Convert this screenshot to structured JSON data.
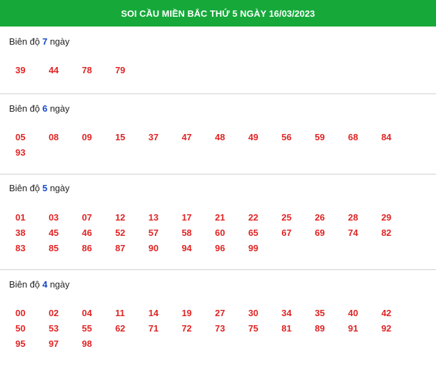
{
  "header": {
    "title": "SOI CẦU MIỀN BẮC THỨ 5 NGÀY 16/03/2023"
  },
  "sections": [
    {
      "label_prefix": "Biên độ",
      "days": "7",
      "label_suffix": "ngày",
      "numbers": [
        "39",
        "44",
        "78",
        "79"
      ]
    },
    {
      "label_prefix": "Biên độ",
      "days": "6",
      "label_suffix": "ngày",
      "numbers": [
        "05",
        "08",
        "09",
        "15",
        "37",
        "47",
        "48",
        "49",
        "56",
        "59",
        "68",
        "84",
        "93"
      ]
    },
    {
      "label_prefix": "Biên độ",
      "days": "5",
      "label_suffix": "ngày",
      "numbers": [
        "01",
        "03",
        "07",
        "12",
        "13",
        "17",
        "21",
        "22",
        "25",
        "26",
        "28",
        "29",
        "38",
        "45",
        "46",
        "52",
        "57",
        "58",
        "60",
        "65",
        "67",
        "69",
        "74",
        "82",
        "83",
        "85",
        "86",
        "87",
        "90",
        "94",
        "96",
        "99"
      ]
    },
    {
      "label_prefix": "Biên độ",
      "days": "4",
      "label_suffix": "ngày",
      "numbers": [
        "00",
        "02",
        "04",
        "11",
        "14",
        "19",
        "27",
        "30",
        "34",
        "35",
        "40",
        "42",
        "50",
        "53",
        "55",
        "62",
        "71",
        "72",
        "73",
        "75",
        "81",
        "89",
        "91",
        "92",
        "95",
        "97",
        "98"
      ]
    }
  ],
  "colors": {
    "header_bg": "#16a93a",
    "number": "#e02424",
    "days_highlight": "#1446c8"
  }
}
